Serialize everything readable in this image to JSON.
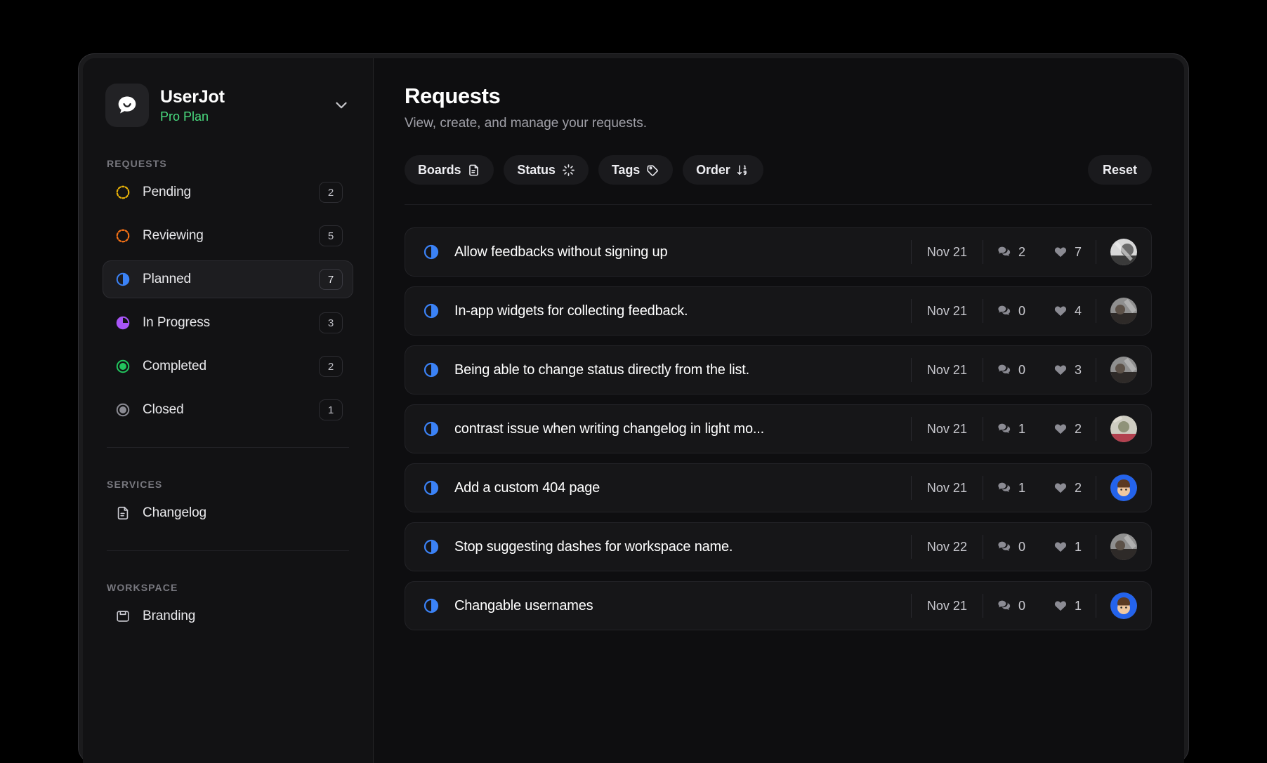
{
  "workspace": {
    "name": "UserJot",
    "plan": "Pro Plan",
    "logo_icon": "speech-bubble-smile-icon",
    "chevron_icon": "chevron-down-icon"
  },
  "sidebar": {
    "sections": [
      {
        "label": "REQUESTS"
      },
      {
        "label": "SERVICES"
      },
      {
        "label": "WORKSPACE"
      }
    ],
    "requests": [
      {
        "label": "Pending",
        "count": "2",
        "icon": "status-pending-icon",
        "color": "#eab308",
        "active": false
      },
      {
        "label": "Reviewing",
        "count": "5",
        "icon": "status-reviewing-icon",
        "color": "#f97316",
        "active": false
      },
      {
        "label": "Planned",
        "count": "7",
        "icon": "status-planned-icon",
        "color": "#3b82f6",
        "active": true
      },
      {
        "label": "In Progress",
        "count": "3",
        "icon": "status-in-progress-icon",
        "color": "#a855f7",
        "active": false
      },
      {
        "label": "Completed",
        "count": "2",
        "icon": "status-completed-icon",
        "color": "#22c55e",
        "active": false
      },
      {
        "label": "Closed",
        "count": "1",
        "icon": "status-closed-icon",
        "color": "#8b8b93",
        "active": false
      }
    ],
    "services": [
      {
        "label": "Changelog",
        "icon": "document-icon"
      }
    ],
    "workspace_items": [
      {
        "label": "Branding",
        "icon": "branding-icon"
      }
    ]
  },
  "header": {
    "title": "Requests",
    "subtitle": "View, create, and manage your requests."
  },
  "filters": {
    "chips": [
      {
        "label": "Boards",
        "icon": "document-icon"
      },
      {
        "label": "Status",
        "icon": "loader-icon"
      },
      {
        "label": "Tags",
        "icon": "tag-icon"
      },
      {
        "label": "Order",
        "icon": "sort-numeric-down-icon"
      }
    ],
    "reset_label": "Reset"
  },
  "requests": {
    "status_icon": "status-planned-icon",
    "comment_icon": "comments-icon",
    "like_icon": "heart-icon",
    "rows": [
      {
        "title": "Allow feedbacks without signing up",
        "date": "Nov 21",
        "comments": "2",
        "likes": "7",
        "avatar": "photo"
      },
      {
        "title": "In-app widgets for collecting feedback.",
        "date": "Nov 21",
        "comments": "0",
        "likes": "4",
        "avatar": "photo"
      },
      {
        "title": "Being able to change status directly from the list.",
        "date": "Nov 21",
        "comments": "0",
        "likes": "3",
        "avatar": "photo"
      },
      {
        "title": "contrast issue when writing changelog in light mo...",
        "date": "Nov 21",
        "comments": "1",
        "likes": "2",
        "avatar": "photo"
      },
      {
        "title": "Add a custom 404 page",
        "date": "Nov 21",
        "comments": "1",
        "likes": "2",
        "avatar": "memoji-blue"
      },
      {
        "title": "Stop suggesting dashes for workspace name.",
        "date": "Nov 22",
        "comments": "0",
        "likes": "1",
        "avatar": "photo"
      },
      {
        "title": "Changable usernames",
        "date": "Nov 21",
        "comments": "0",
        "likes": "1",
        "avatar": "memoji-blue"
      }
    ]
  }
}
